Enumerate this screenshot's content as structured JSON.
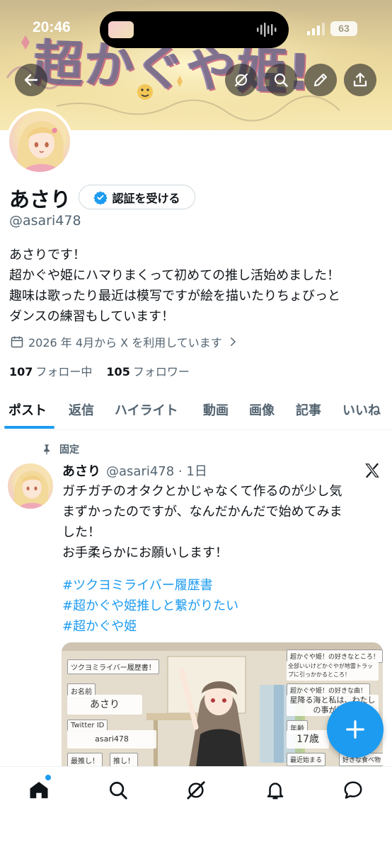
{
  "status_bar": {
    "time": "20:46",
    "battery": "63"
  },
  "banner": {
    "title_art": "超かぐや姫!"
  },
  "header_actions": {
    "back": "back-arrow-icon",
    "grok": "grok-icon",
    "search": "search-icon",
    "edit": "pencil-icon",
    "share": "share-icon"
  },
  "profile": {
    "name": "あさり",
    "verify_label": "認証を受ける",
    "handle": "@asari478",
    "bio": "あさりです！\n超かぐや姫にハマりまくって初めての推し活始めました！\n趣味は歌ったり最近は模写ですが絵を描いたりちょびっと\nダンスの練習もしています！",
    "joined": "2026 年 4月から X を利用しています",
    "following_count": "107",
    "following_label": "フォロー中",
    "followers_count": "105",
    "followers_label": "フォロワー"
  },
  "tabs": [
    {
      "label": "ポスト",
      "active": true
    },
    {
      "label": "返信",
      "active": false
    },
    {
      "label": "ハイライト",
      "active": false
    },
    {
      "label": "動画",
      "active": false
    },
    {
      "label": "画像",
      "active": false
    },
    {
      "label": "記事",
      "active": false
    },
    {
      "label": "いいね",
      "active": false
    }
  ],
  "post": {
    "pinned_label": "固定",
    "name": "あさり",
    "meta": "@asari478 · 1日",
    "text": "ガチガチのオタクとかじゃなくて作るのが少し気\nまずかったのですが、なんだかんだで始めてみま\nした！\nお手柔らかにお願いします！",
    "hashtags": [
      "#ツクヨミライバー履歴書",
      "#超かぐや姫推しと繋がりたい",
      "#超かぐや姫"
    ],
    "image": {
      "card_title": "ツクヨミライバー履歴書！",
      "name_label": "お名前",
      "name_value": "あさり",
      "twitter_label": "Twitter ID",
      "twitter_value": "asari478",
      "oshi_label": "最推し！",
      "oshi2_label": "推し！",
      "fav_point_label": "超かぐや姫！の好きなところ！",
      "fav_point_value": "全部いいけどかぐやが地雷トラップに引っかかるところ！",
      "fav_song_label": "超かぐや姫！の好きな曲！",
      "fav_song_value": "星降る海と私は、わたしの事が好き",
      "age_label": "年齢",
      "age_value": "17歳",
      "recent_label": "最近始まる",
      "fav_food_label": "好きな食べ物"
    }
  },
  "colors": {
    "accent": "#1d9bf0",
    "text": "#0f1419",
    "muted": "#536471"
  },
  "bottom_nav": [
    "home-icon",
    "search-icon",
    "grok-icon",
    "bell-icon",
    "messages-icon"
  ]
}
